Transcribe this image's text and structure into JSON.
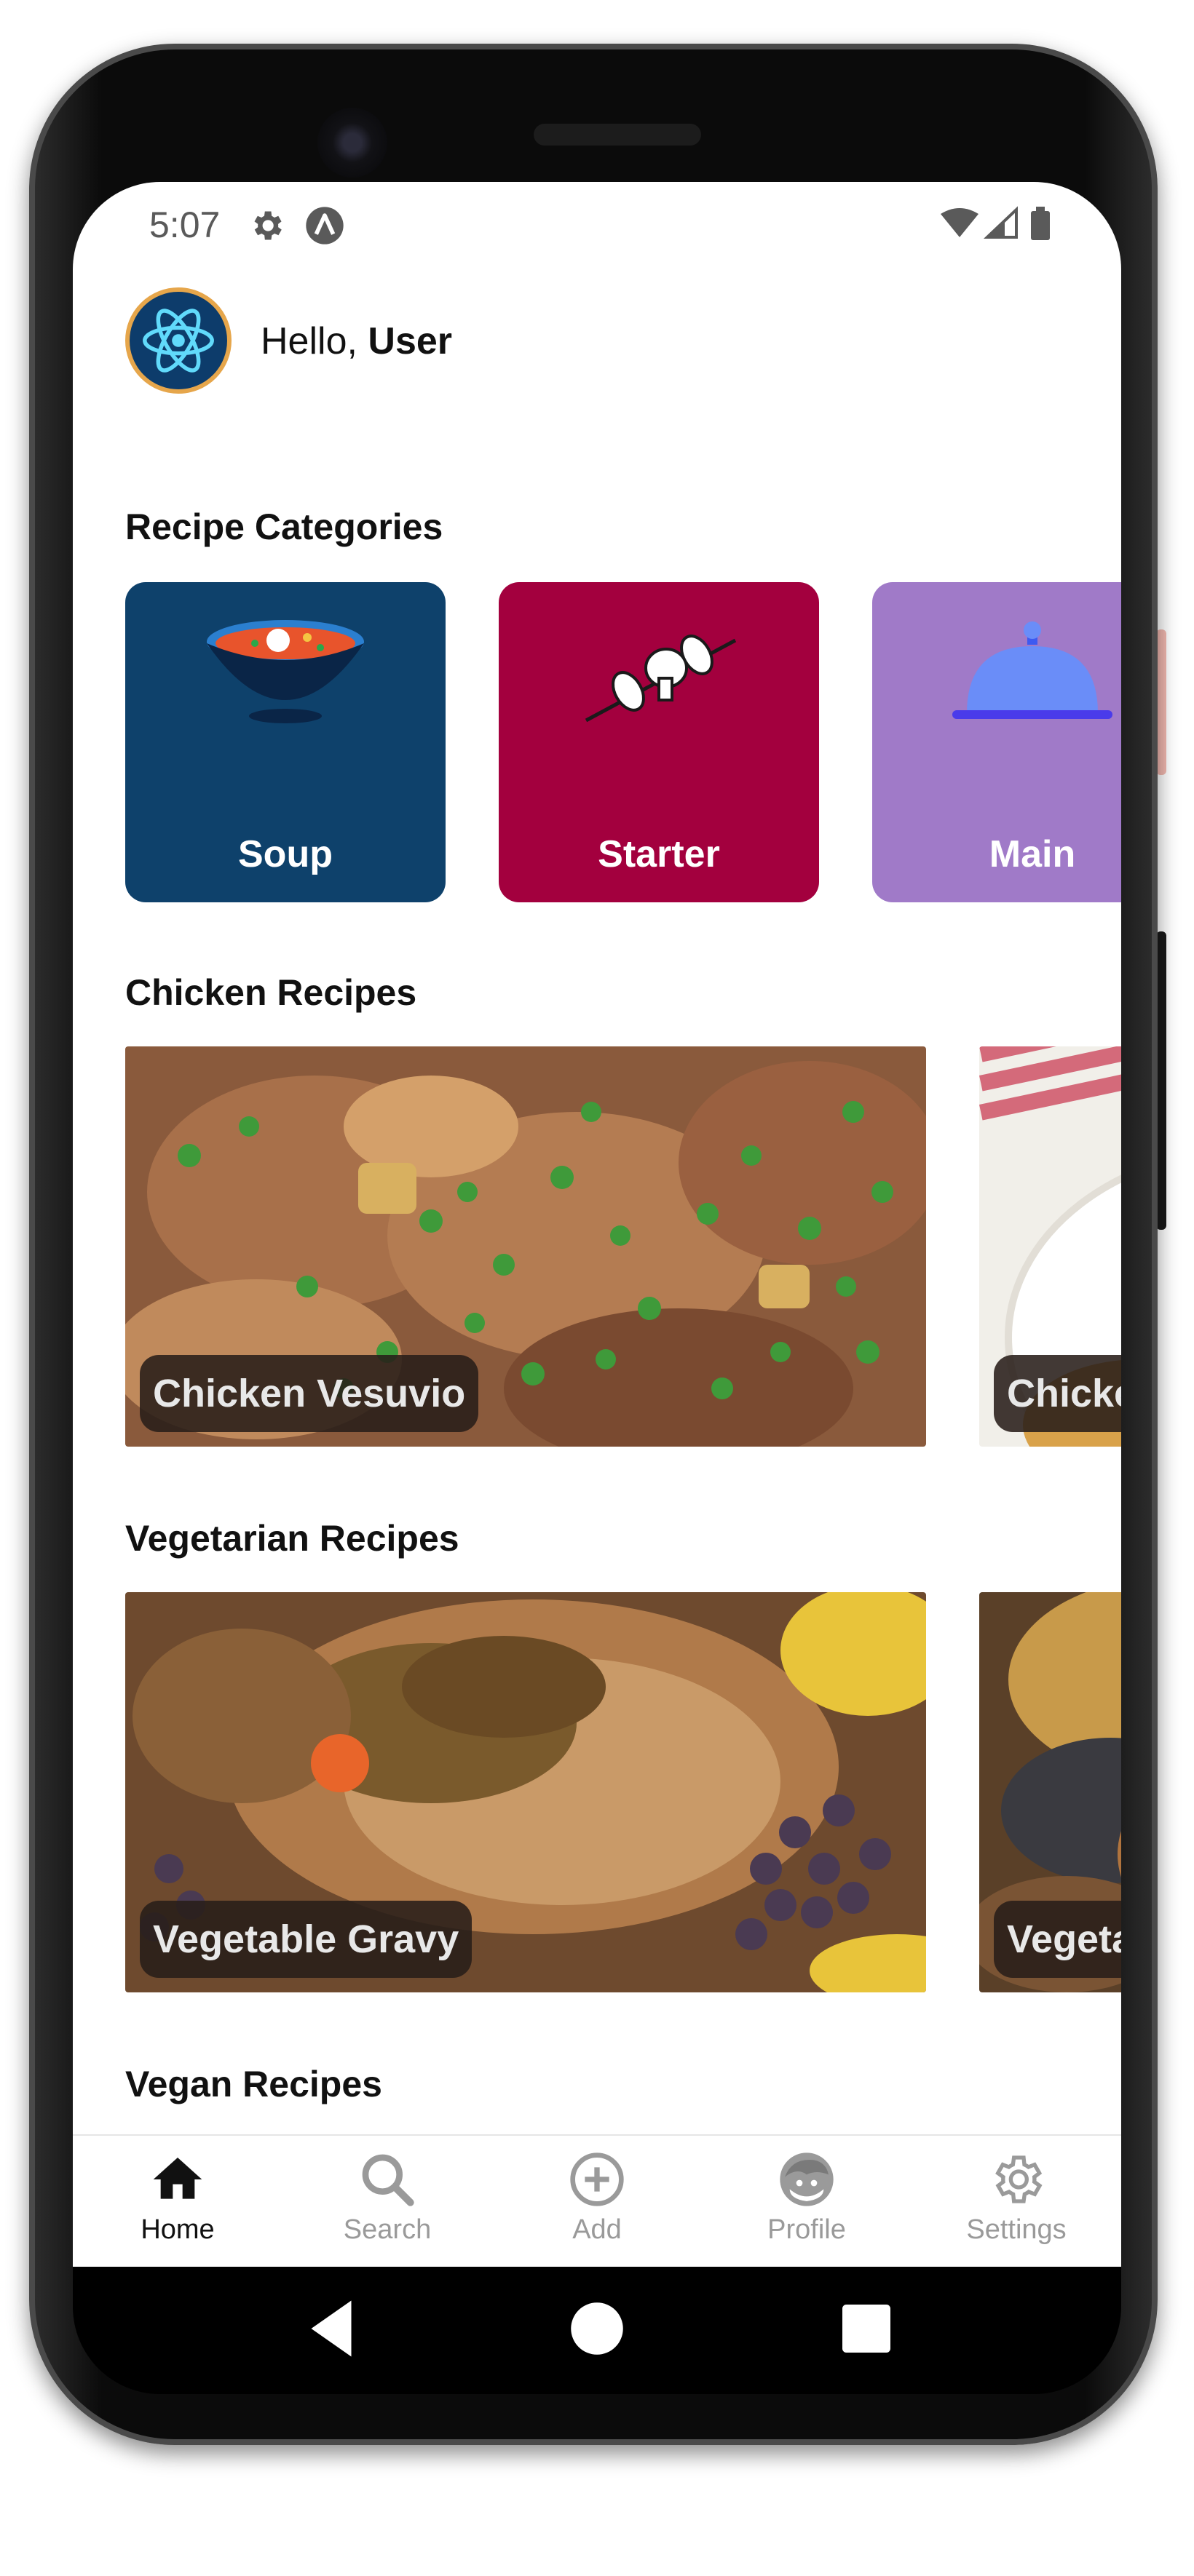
{
  "status_bar": {
    "time": "5:07",
    "icons": [
      "gear-icon",
      "a-icon",
      "wifi-icon",
      "signal-icon",
      "battery-icon"
    ]
  },
  "header": {
    "greeting_prefix": "Hello, ",
    "user_name": "User",
    "avatar_icon": "react-atom-icon"
  },
  "categories": {
    "title": "Recipe Categories",
    "items": [
      {
        "label": "Soup",
        "icon": "soup-bowl-icon",
        "color": "#0e416b"
      },
      {
        "label": "Starter",
        "icon": "skewer-icon",
        "color": "#a3003e"
      },
      {
        "label": "Main",
        "icon": "cloche-icon",
        "color": "#a07ac8"
      }
    ]
  },
  "chicken": {
    "title": "Chicken Recipes",
    "items": [
      {
        "label": "Chicken Vesuvio"
      },
      {
        "label": "Chicke"
      }
    ]
  },
  "vegetarian": {
    "title": "Vegetarian Recipes",
    "items": [
      {
        "label": "Vegetable Gravy"
      },
      {
        "label": "Vegeta"
      }
    ]
  },
  "vegan": {
    "title": "Vegan Recipes"
  },
  "bottom_nav": [
    {
      "label": "Home",
      "icon": "home-icon",
      "active": true
    },
    {
      "label": "Search",
      "icon": "search-icon",
      "active": false
    },
    {
      "label": "Add",
      "icon": "add-circle-icon",
      "active": false
    },
    {
      "label": "Profile",
      "icon": "profile-face-icon",
      "active": false
    },
    {
      "label": "Settings",
      "icon": "gear-icon",
      "active": false
    }
  ],
  "colors": {
    "soup": "#0e416b",
    "starter": "#a3003e",
    "main": "#a07ac8",
    "nav_active": "#111111",
    "nav_inactive": "#9a9a9a"
  }
}
